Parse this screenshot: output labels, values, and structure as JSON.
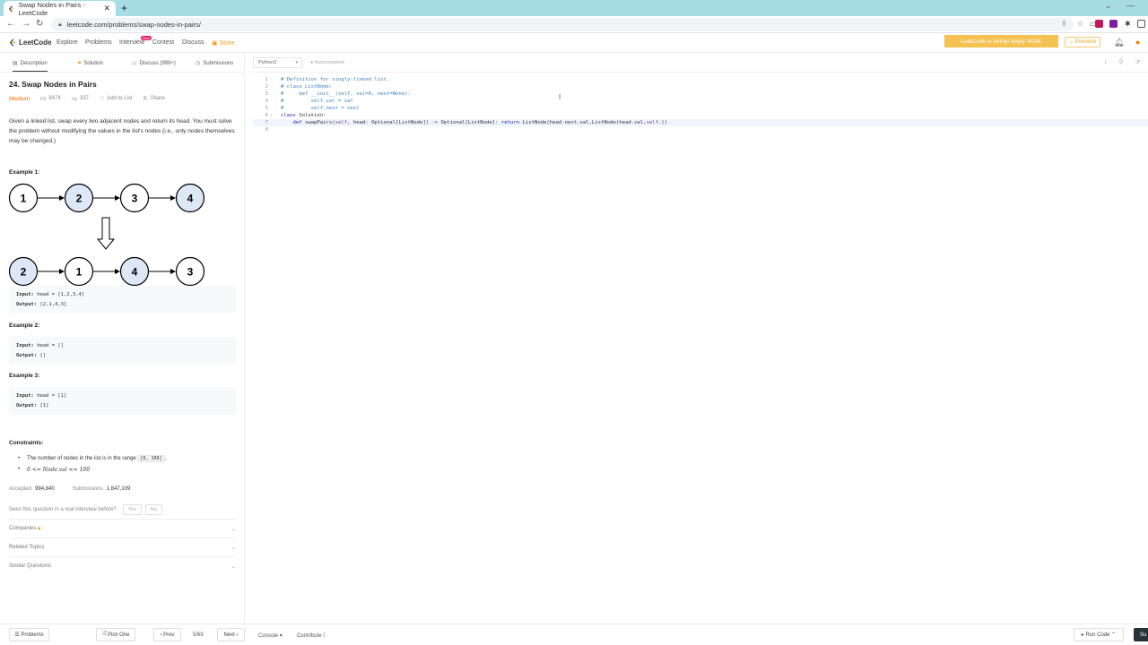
{
  "browser": {
    "tab_title": "Swap Nodes in Pairs - LeetCode",
    "url": "leetcode.com/problems/swap-nodes-in-pairs/"
  },
  "nav": {
    "logo": "LeetCode",
    "links": [
      "Explore",
      "Problems",
      "Interview",
      "Contest",
      "Discuss",
      "Store"
    ],
    "new_badge": "New",
    "hiring": "LeetCode is hiring! Apply NOW.",
    "premium": "Premium",
    "accent_color": "#f5c151"
  },
  "subtabs": {
    "description": "Description",
    "solution": "Solution",
    "discuss": "Discuss (999+)",
    "submissions": "Submissions"
  },
  "problem": {
    "title": "24. Swap Nodes in Pairs",
    "difficulty": "Medium",
    "difficulty_color": "#ef6c00",
    "likes": "8474",
    "dislikes": "337",
    "add_to_list": "Add to List",
    "share": "Share",
    "description": "Given a linked list, swap every two adjacent nodes and return its head. You must solve the problem without modifying the values in the list's nodes (i.e., only nodes themselves may be changed.)"
  },
  "examples": [
    {
      "heading": "Example 1:",
      "input_label": "Input:",
      "input": "head = [1,2,3,4]",
      "output_label": "Output:",
      "output": "[2,1,4,3]"
    },
    {
      "heading": "Example 2:",
      "input_label": "Input:",
      "input": "head = []",
      "output_label": "Output:",
      "output": "[]"
    },
    {
      "heading": "Example 3:",
      "input_label": "Input:",
      "input": "head = [1]",
      "output_label": "Output:",
      "output": "[1]"
    }
  ],
  "diagram": {
    "row1": [
      "1",
      "2",
      "3",
      "4"
    ],
    "row2": [
      "2",
      "1",
      "4",
      "3"
    ],
    "highlight_fill": "#dde8f7"
  },
  "constraints": {
    "heading": "Constraints:",
    "c1_text": "The number of nodes in the list is in the range",
    "c1_code": "[0, 100]",
    "c1_end": ".",
    "c2": "0 <= Node.val <= 100"
  },
  "stats": {
    "accepted_label": "Accepted",
    "accepted": "994,840",
    "submissions_label": "Submissions",
    "submissions": "1,647,109"
  },
  "seen": {
    "question": "Seen this question in a real interview before?",
    "yes": "Yes",
    "no": "No"
  },
  "accordions": [
    "Companies",
    "Related Topics",
    "Similar Questions"
  ],
  "editor": {
    "language": "Python3",
    "autocomplete": "Autocomplete",
    "lines": [
      "# Definition for singly-linked list.",
      "# class ListNode:",
      "#     def __init__(self, val=0, next=None):",
      "#         self.val = val",
      "#         self.next = next",
      "class Solution:",
      "    def swapPairs(self, head: Optional[ListNode]) -> Optional[ListNode]: return ListNode(head.next.val,ListNode(head.val,self.))",
      ""
    ],
    "line_numbers": [
      "1",
      "2",
      "3",
      "4",
      "5",
      "6",
      "7",
      "8"
    ],
    "active_line": 7
  },
  "bottom": {
    "problems": "Problems",
    "pick_one": "Pick One",
    "prev": "Prev",
    "page": "5/69",
    "next": "Next",
    "console": "Console",
    "contribute": "Contribute",
    "run_code": "Run Code",
    "submit": "Su"
  }
}
